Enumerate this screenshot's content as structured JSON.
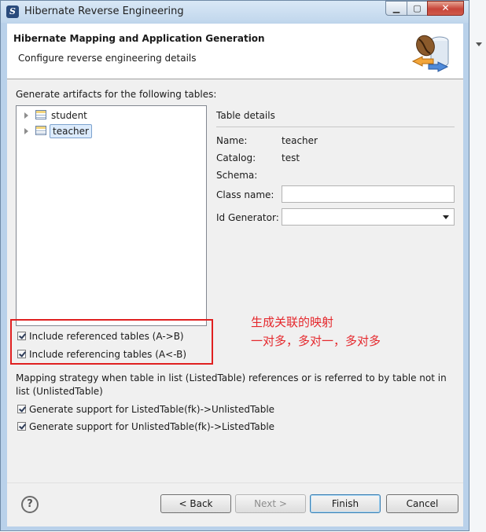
{
  "window": {
    "title": "Hibernate Reverse Engineering",
    "app_icon_letter": "S"
  },
  "banner": {
    "title": "Hibernate Mapping and Application Generation",
    "subtitle": "Configure reverse engineering details",
    "icon": "database-coffee-bean-icon"
  },
  "artifacts_label": "Generate artifacts for the following tables:",
  "tree": {
    "items": [
      {
        "label": "student",
        "selected": false
      },
      {
        "label": "teacher",
        "selected": true
      }
    ]
  },
  "details": {
    "title": "Table details",
    "name_label": "Name:",
    "name_value": "teacher",
    "catalog_label": "Catalog:",
    "catalog_value": "test",
    "schema_label": "Schema:",
    "schema_value": "",
    "class_name_label": "Class name:",
    "class_name_value": "",
    "id_generator_label": "Id Generator:",
    "id_generator_value": ""
  },
  "checkboxes": {
    "include_referenced": {
      "label": "Include referenced tables (A->B)",
      "checked": true
    },
    "include_referencing": {
      "label": "Include referencing tables (A<-B)",
      "checked": true
    },
    "gen_listed": {
      "label": "Generate support for ListedTable(fk)->UnlistedTable",
      "checked": true
    },
    "gen_unlisted": {
      "label": "Generate support for UnlistedTable(fk)->ListedTable",
      "checked": true
    }
  },
  "annotation": {
    "line1": "生成关联的映射",
    "line2": "一对多，多对一，多对多",
    "color": "#e5282d"
  },
  "mapping_text": "Mapping strategy when table in list (ListedTable) references or is referred to by table not in list (UnlistedTable)",
  "buttons": {
    "help": "?",
    "back": "< Back",
    "next": "Next >",
    "finish": "Finish",
    "cancel": "Cancel"
  }
}
